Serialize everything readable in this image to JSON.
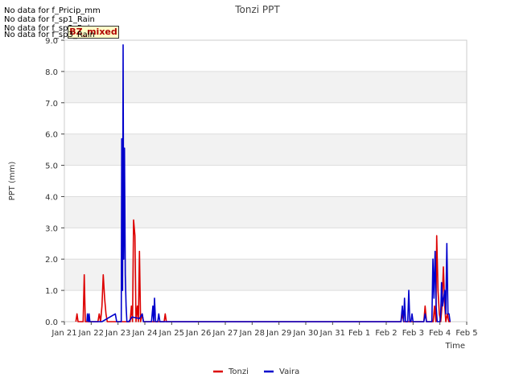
{
  "no_data_messages": [
    "No data for f_Pricip_mm",
    "No data for f_sp1_Rain",
    "No data for f_sp2_Rain",
    "No data for f_sp3_Rain"
  ],
  "badge_label": "BZ_mixed",
  "chart_data": {
    "type": "line",
    "title": "Tonzi PPT",
    "xlabel": "Time",
    "ylabel": "PPT (mm)",
    "ylim": [
      0,
      9
    ],
    "xlim": [
      0,
      15
    ],
    "x_unit": "days from Jan 21",
    "x_ticks": [
      {
        "x": 0,
        "label": "Jan 21"
      },
      {
        "x": 1,
        "label": "Jan 22"
      },
      {
        "x": 2,
        "label": "Jan 23"
      },
      {
        "x": 3,
        "label": "Jan 24"
      },
      {
        "x": 4,
        "label": "Jan 25"
      },
      {
        "x": 5,
        "label": "Jan 26"
      },
      {
        "x": 6,
        "label": "Jan 27"
      },
      {
        "x": 7,
        "label": "Jan 28"
      },
      {
        "x": 8,
        "label": "Jan 29"
      },
      {
        "x": 9,
        "label": "Jan 30"
      },
      {
        "x": 10,
        "label": "Jan 31"
      },
      {
        "x": 11,
        "label": "Feb 1"
      },
      {
        "x": 12,
        "label": "Feb 2"
      },
      {
        "x": 13,
        "label": "Feb 3"
      },
      {
        "x": 14,
        "label": "Feb 4"
      },
      {
        "x": 15,
        "label": "Feb 5"
      }
    ],
    "y_ticks": [
      0.0,
      1.0,
      2.0,
      3.0,
      4.0,
      5.0,
      6.0,
      7.0,
      8.0,
      9.0
    ],
    "y_tick_labels": [
      "0.0",
      "1.0",
      "2.0",
      "3.0",
      "4.0",
      "5.0",
      "6.0",
      "7.0",
      "8.0",
      "9.0"
    ],
    "grid": true,
    "legend_position": "bottom-center",
    "series": [
      {
        "name": "Tonzi",
        "color": "#dd0000",
        "points": [
          [
            0.43,
            0
          ],
          [
            0.47,
            0.25
          ],
          [
            0.51,
            0
          ],
          [
            0.7,
            0
          ],
          [
            0.74,
            1.5
          ],
          [
            0.78,
            0
          ],
          [
            1.25,
            0
          ],
          [
            1.3,
            0.25
          ],
          [
            1.35,
            0
          ],
          [
            1.4,
            0.5
          ],
          [
            1.45,
            1.5
          ],
          [
            1.5,
            0.75
          ],
          [
            1.55,
            0.25
          ],
          [
            1.6,
            0
          ],
          [
            2.45,
            0
          ],
          [
            2.5,
            0.5
          ],
          [
            2.54,
            0
          ],
          [
            2.58,
            3.25
          ],
          [
            2.63,
            2.75
          ],
          [
            2.67,
            0
          ],
          [
            2.72,
            0.5
          ],
          [
            2.76,
            0
          ],
          [
            2.8,
            2.25
          ],
          [
            2.84,
            0
          ],
          [
            2.9,
            0.25
          ],
          [
            2.95,
            0
          ],
          [
            3.72,
            0
          ],
          [
            3.76,
            0.25
          ],
          [
            3.8,
            0
          ],
          [
            12.55,
            0
          ],
          [
            12.6,
            0.25
          ],
          [
            12.65,
            0
          ],
          [
            13.4,
            0
          ],
          [
            13.45,
            0.5
          ],
          [
            13.5,
            0
          ],
          [
            13.75,
            0
          ],
          [
            13.8,
            0.5
          ],
          [
            13.85,
            0
          ],
          [
            13.88,
            2.75
          ],
          [
            13.93,
            1.0
          ],
          [
            13.98,
            0.25
          ],
          [
            14.03,
            0
          ],
          [
            14.08,
            0.5
          ],
          [
            14.13,
            1.75
          ],
          [
            14.18,
            0.5
          ],
          [
            14.22,
            0
          ],
          [
            14.28,
            0.25
          ],
          [
            14.33,
            0
          ],
          [
            14.4,
            0
          ]
        ]
      },
      {
        "name": "Vaira",
        "color": "#0000cc",
        "points": [
          [
            0.84,
            0
          ],
          [
            0.86,
            0.25
          ],
          [
            0.9,
            0
          ],
          [
            0.92,
            0.25
          ],
          [
            0.95,
            0
          ],
          [
            1.4,
            0
          ],
          [
            1.9,
            0.25
          ],
          [
            1.95,
            0
          ],
          [
            2.12,
            0
          ],
          [
            2.14,
            5.85
          ],
          [
            2.17,
            1.0
          ],
          [
            2.19,
            8.85
          ],
          [
            2.21,
            2.0
          ],
          [
            2.24,
            5.55
          ],
          [
            2.27,
            1.5
          ],
          [
            2.3,
            0.5
          ],
          [
            2.33,
            0
          ],
          [
            2.4,
            0
          ],
          [
            2.52,
            0.15
          ],
          [
            2.8,
            0.1
          ],
          [
            2.9,
            0.25
          ],
          [
            2.95,
            0
          ],
          [
            3.25,
            0
          ],
          [
            3.3,
            0.5
          ],
          [
            3.33,
            0
          ],
          [
            3.36,
            0.75
          ],
          [
            3.4,
            0
          ],
          [
            3.48,
            0
          ],
          [
            3.52,
            0.25
          ],
          [
            3.56,
            0
          ],
          [
            12.55,
            0
          ],
          [
            12.6,
            0.5
          ],
          [
            12.65,
            0
          ],
          [
            12.68,
            0.75
          ],
          [
            12.72,
            0
          ],
          [
            12.8,
            0
          ],
          [
            12.84,
            1.0
          ],
          [
            12.88,
            0
          ],
          [
            12.92,
            0
          ],
          [
            12.96,
            0.25
          ],
          [
            13.0,
            0
          ],
          [
            13.4,
            0
          ],
          [
            13.45,
            0.25
          ],
          [
            13.5,
            0
          ],
          [
            13.7,
            0
          ],
          [
            13.74,
            2.0
          ],
          [
            13.78,
            0.75
          ],
          [
            13.82,
            2.25
          ],
          [
            13.86,
            0.5
          ],
          [
            13.9,
            0
          ],
          [
            14.0,
            0
          ],
          [
            14.03,
            0.25
          ],
          [
            14.06,
            1.25
          ],
          [
            14.1,
            0.5
          ],
          [
            14.14,
            0.75
          ],
          [
            14.18,
            1.0
          ],
          [
            14.22,
            0.25
          ],
          [
            14.26,
            2.5
          ],
          [
            14.3,
            0.25
          ],
          [
            14.34,
            0.25
          ],
          [
            14.38,
            0
          ]
        ]
      }
    ]
  }
}
